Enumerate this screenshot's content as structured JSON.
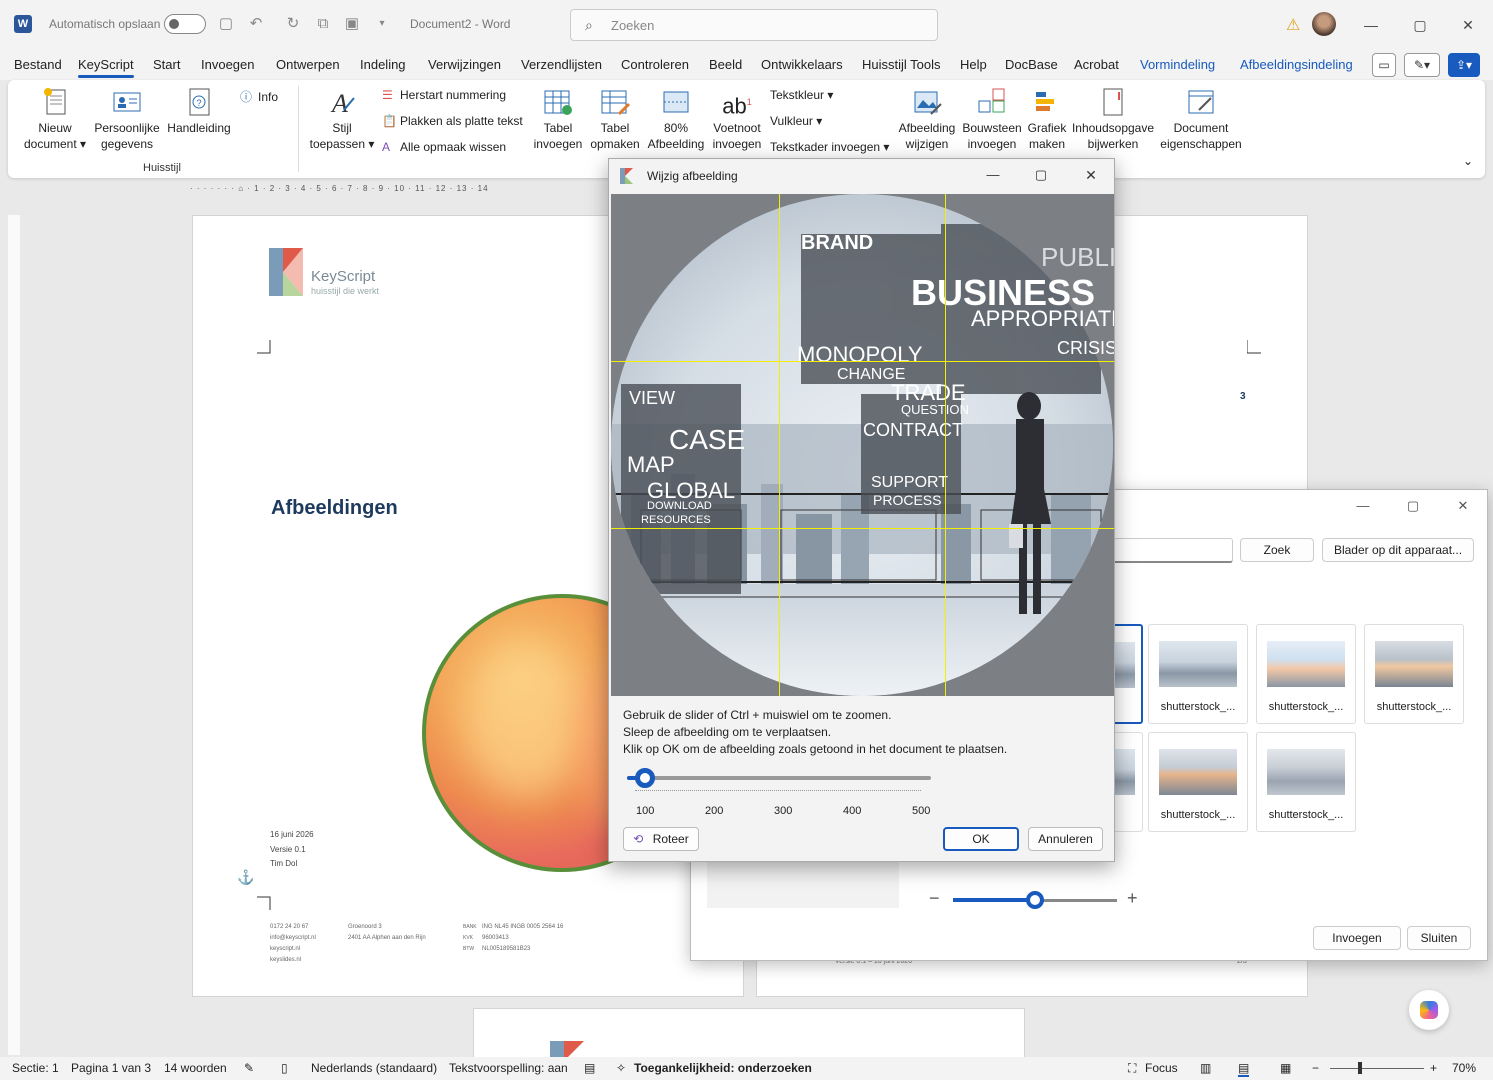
{
  "titlebar": {
    "autosave_label": "Automatisch opslaan",
    "doc_title": "Document2  -  Word",
    "search_placeholder": "Zoeken"
  },
  "menu": {
    "tabs": [
      "Bestand",
      "KeyScript",
      "Start",
      "Invoegen",
      "Ontwerpen",
      "Indeling",
      "Verwijzingen",
      "Verzendlijsten",
      "Controleren",
      "Beeld",
      "Ontwikkelaars",
      "Huisstijl Tools",
      "Help",
      "DocBase",
      "Acrobat",
      "Vormindeling",
      "Afbeeldingsindeling"
    ],
    "active_tab": "KeyScript"
  },
  "ribbon": {
    "nieuw_document": "Nieuw document",
    "persoonlijke_gegevens": "Persoonlijke gegevens",
    "handleiding": "Handleiding",
    "info": "Info",
    "group_huisstijl": "Huisstijl",
    "stijl_toepassen": "Stijl toepassen",
    "herstart_nummering": "Herstart nummering",
    "plakken_platte_tekst": "Plakken als platte tekst",
    "alle_opmaak_wissen": "Alle opmaak wissen",
    "tabel_invoegen": "Tabel invoegen",
    "tabel_opmaken": "Tabel opmaken",
    "afbeelding_80": "80% Afbeelding",
    "voetnoot_invoegen": "Voetnoot invoegen",
    "tekstkleur": "Tekstkleur",
    "vulkleur": "Vulkleur",
    "tekstkader_invoegen": "Tekstkader invoegen",
    "afbeelding_wijzigen": "Afbeelding wijzigen",
    "bouwsteen_invoegen": "Bouwsteen invoegen",
    "grafiek_maken": "Grafiek maken",
    "inhoudsopgave_bijwerken": "Inhoudsopgave bijwerken",
    "document_eigenschappen": "Document eigenschappen"
  },
  "document": {
    "logo_name": "KeyScript",
    "logo_tagline": "huisstijl die werkt",
    "heading": "Afbeeldingen",
    "date": "16 juni 2026",
    "version": "Versie 0.1",
    "author": "Tim Dol",
    "footer_contact": "0172 24 20 67\ninfo@keyscript.nl\nkeyscript.nl\nkeyslides.nl",
    "footer_address": "Groenoord 3\n2401 AA Alphen aan den Rijn",
    "footer_bank_labels": "BANK\nKVK\nBTW",
    "footer_bank_values": "ING NL45 INGB 0005 2564 16\n96003413\nNL005189581B23",
    "page_number_right": "3",
    "page2_footer": "Versie 0.1 – 16 juni 2026",
    "page2_pagenum": "2/3"
  },
  "picture_dialog": {
    "search_button": "Zoek",
    "browse_button": "Blader op dit apparaat...",
    "thumbnails": [
      "shutterstock_...",
      "shutterstock_...",
      "shutterstock_...",
      "shutterstock_...",
      "shutterstock_..."
    ],
    "insert_button": "Invoegen",
    "close_button": "Sluiten"
  },
  "edit_dialog": {
    "title": "Wijzig afbeelding",
    "help_line1": "Gebruik de slider of Ctrl + muiswiel om te zoomen.",
    "help_line2": "Sleep de afbeelding om te verplaatsen.",
    "help_line3": "Klik op OK om de afbeelding zoals getoond in het document te plaatsen.",
    "zoom_value": 100,
    "zoom_min": 100,
    "zoom_max": 500,
    "zoom_labels": [
      "100",
      "200",
      "300",
      "400",
      "500"
    ],
    "rotate_button": "Roteer",
    "ok_button": "OK",
    "cancel_button": "Annuleren",
    "image_words": [
      "BRAND",
      "BUSINESS",
      "APPROPRIATE",
      "MONOPOLY",
      "CHANGE",
      "TRADE",
      "CASE",
      "GLOBAL",
      "CONTRACT",
      "SUPPORT",
      "PROCESS",
      "VIEW",
      "MAP",
      "QUESTION",
      "CRISIS",
      "PUBLIC",
      "DOWNLOAD",
      "RESOURCES"
    ]
  },
  "statusbar": {
    "sectie": "Sectie: 1",
    "pagina": "Pagina 1 van 3",
    "woorden": "14 woorden",
    "taal": "Nederlands (standaard)",
    "tekstvoorspelling": "Tekstvoorspelling: aan",
    "toegankelijkheid": "Toegankelijkheid: onderzoeken",
    "focus": "Focus",
    "zoom": "70%"
  },
  "colors": {
    "accent": "#185abd",
    "heading": "#1f3a5f",
    "circle_border": "#5a8f3a",
    "guide": "#f0f000"
  }
}
